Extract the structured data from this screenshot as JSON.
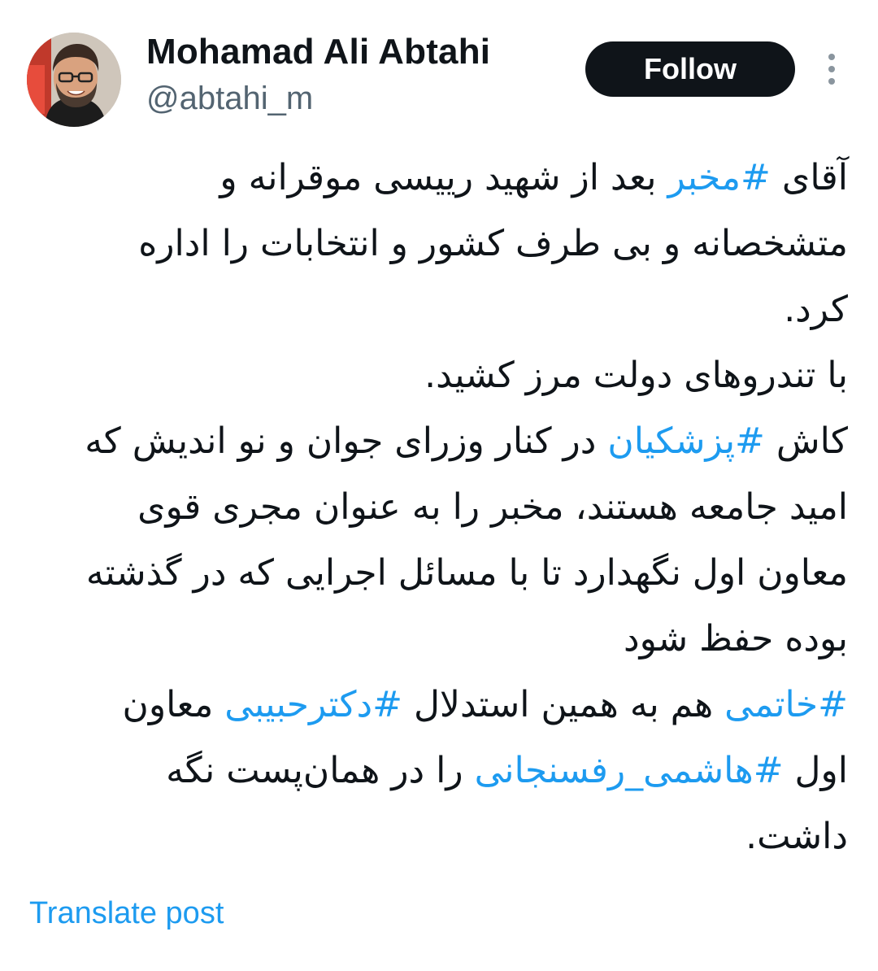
{
  "author": {
    "display_name": "Mohamad Ali Abtahi",
    "handle": "@abtahi_m"
  },
  "actions": {
    "follow_label": "Follow",
    "more_icon": "more-vertical-icon"
  },
  "post": {
    "lines": [
      [
        {
          "text": "آقای "
        },
        {
          "text": "#مخبر",
          "hashtag": true
        },
        {
          "text": " بعد از شهید رییسی موقرانه و"
        }
      ],
      [
        {
          "text": "متشخصانه و بی طرف کشور و انتخابات را اداره"
        }
      ],
      [
        {
          "text": "کرد."
        }
      ],
      [
        {
          "text": "با تندروهای دولت مرز کشید."
        }
      ],
      [
        {
          "text": "کاش "
        },
        {
          "text": "#پزشکیان",
          "hashtag": true
        },
        {
          "text": " در کنار وزرای جوان و نو اندیش که"
        }
      ],
      [
        {
          "text": "امید جامعه هستند، مخبر را به عنوان مجری قوی"
        }
      ],
      [
        {
          "text": "معاون اول نگهدارد تا با مسائل اجرایی که در گذشته"
        }
      ],
      [
        {
          "text": "بوده حفظ شود"
        }
      ],
      [
        {
          "text": "#خاتمی",
          "hashtag": true
        },
        {
          "text": " هم به همین استدلال "
        },
        {
          "text": "#دکترحبیبی",
          "hashtag": true
        },
        {
          "text": " معاون"
        }
      ],
      [
        {
          "text": "اول "
        },
        {
          "text": "#هاشمی_رفسنجانی",
          "hashtag": true
        },
        {
          "text": " را در همان‌پست نگه"
        }
      ],
      [
        {
          "text": "داشت."
        }
      ]
    ]
  },
  "footer": {
    "translate_label": "Translate post"
  },
  "colors": {
    "text": "#0f1419",
    "secondary_text": "#536471",
    "link": "#1d9bf0",
    "follow_bg": "#0f1419",
    "follow_text": "#ffffff"
  }
}
